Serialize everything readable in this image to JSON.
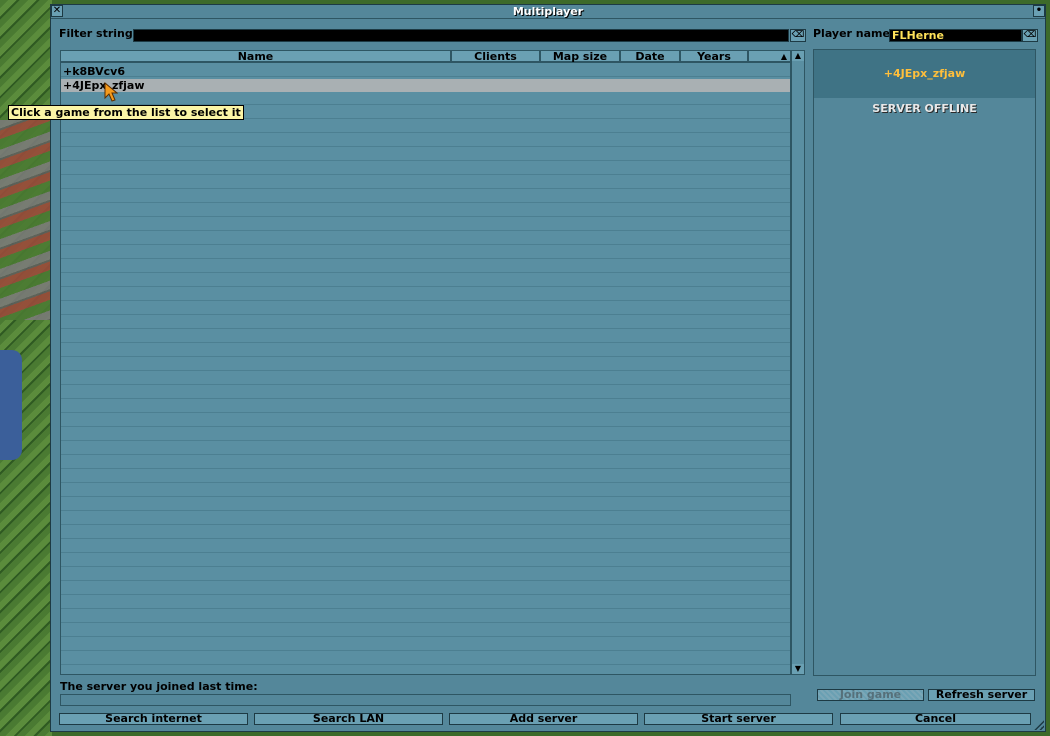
{
  "window": {
    "title": "Multiplayer",
    "close_glyph": "✕",
    "sticky_glyph": "•"
  },
  "filter": {
    "label": "Filter string:",
    "value": "",
    "clear_glyph": "⌫"
  },
  "player": {
    "label": "Player name:",
    "value": "FLHerne",
    "clear_glyph": "⌫"
  },
  "columns": [
    "Name",
    "Clients",
    "Map size",
    "Date",
    "Years"
  ],
  "sort_indicator": "▲",
  "servers": [
    {
      "name": "+k8BVcv6",
      "selected": false
    },
    {
      "name": "+4JEpx_zfjaw",
      "selected": true
    }
  ],
  "tooltip": "Click a game from the list to select it",
  "info": {
    "server_name": "+4JEpx_zfjaw",
    "status": "SERVER OFFLINE"
  },
  "last_server": {
    "label": "The server you joined last time:",
    "value": ""
  },
  "buttons": {
    "join_game": "Join game",
    "refresh_server": "Refresh server",
    "search_internet": "Search internet",
    "search_lan": "Search LAN",
    "add_server": "Add server",
    "start_server": "Start server",
    "cancel": "Cancel"
  },
  "scroll": {
    "up": "▲",
    "down": "▼"
  },
  "colors": {
    "window": "#54879a",
    "highlight": "#ffbf3b",
    "edit_text": "#ffe25a"
  }
}
